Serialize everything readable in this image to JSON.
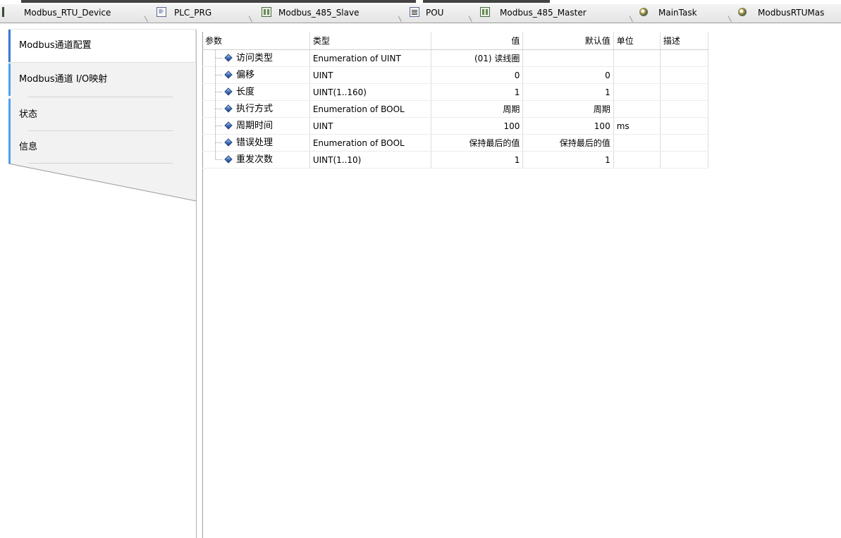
{
  "tabs": [
    {
      "label": "Modbus_RTU_Device",
      "icon": "device-icon"
    },
    {
      "label": "PLC_PRG",
      "icon": "program-icon"
    },
    {
      "label": "Modbus_485_Slave",
      "icon": "device-icon"
    },
    {
      "label": "POU",
      "icon": "document-icon"
    },
    {
      "label": "Modbus_485_Master",
      "icon": "device-icon"
    },
    {
      "label": "MainTask",
      "icon": "task-icon"
    },
    {
      "label": "ModbusRTUMas",
      "icon": "task-icon"
    }
  ],
  "nav": {
    "items": [
      {
        "label": "Modbus通道配置"
      },
      {
        "label": "Modbus通道 I/O映射"
      },
      {
        "label": "状态"
      },
      {
        "label": "信息"
      }
    ]
  },
  "table": {
    "headers": {
      "param": "参数",
      "type": "类型",
      "value": "值",
      "default": "默认值",
      "unit": "单位",
      "desc": "描述"
    },
    "rows": [
      {
        "param": "访问类型",
        "type": "Enumeration of UINT",
        "value": "(01) 读线圈",
        "default": "",
        "unit": "",
        "desc": ""
      },
      {
        "param": "偏移",
        "type": "UINT",
        "value": "0",
        "default": "0",
        "unit": "",
        "desc": ""
      },
      {
        "param": "长度",
        "type": "UINT(1..160)",
        "value": "1",
        "default": "1",
        "unit": "",
        "desc": ""
      },
      {
        "param": "执行方式",
        "type": "Enumeration of BOOL",
        "value": "周期",
        "default": "周期",
        "unit": "",
        "desc": ""
      },
      {
        "param": "周期时间",
        "type": "UINT",
        "value": "100",
        "default": "100",
        "unit": "ms",
        "desc": ""
      },
      {
        "param": "错误处理",
        "type": "Enumeration of BOOL",
        "value": "保持最后的值",
        "default": "保持最后的值",
        "unit": "",
        "desc": ""
      },
      {
        "param": "重发次数",
        "type": "UINT(1..10)",
        "value": "1",
        "default": "1",
        "unit": "",
        "desc": ""
      }
    ]
  },
  "colors": {
    "active_nav_accent": "#3a7bd5",
    "nav_accent": "#4aa3f0",
    "param_icon": "#3a6cb8"
  }
}
